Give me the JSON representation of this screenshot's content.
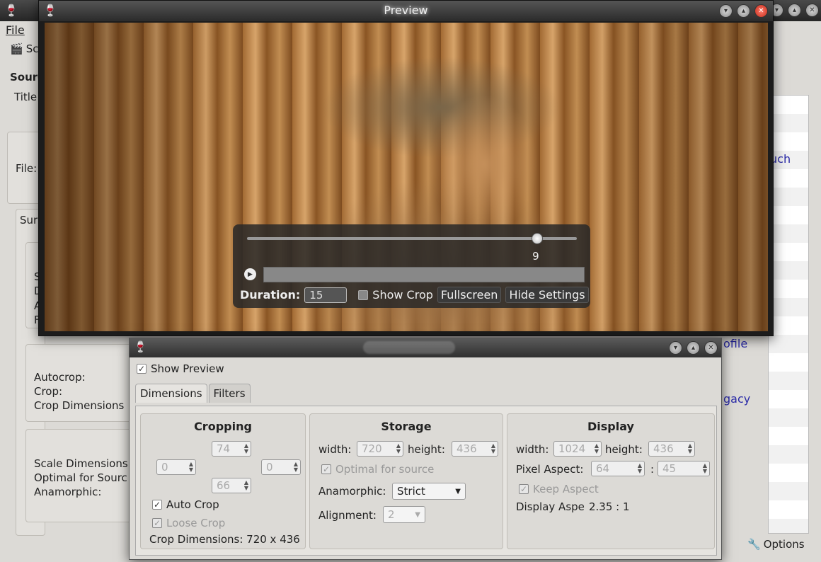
{
  "main": {
    "menu_file": "File",
    "toolbar_label": "Sc",
    "source_label": "Sourc",
    "title_label": "Title",
    "file_label": "File:",
    "summary_tab": "Sur",
    "group_letters": [
      "S",
      "D",
      "A",
      "F"
    ],
    "autocrop_label": "Autocrop:",
    "crop_label": "Crop:",
    "crop_dimensions_label": "Crop Dimensions",
    "scale_dimensions_label": "Scale Dimensions",
    "optimal_label": "Optimal for Sourc",
    "anamorphic_label": "Anamorphic:",
    "right_links": [
      "uch",
      "ofile",
      "gacy"
    ],
    "options_label": "Options"
  },
  "preview": {
    "title": "Preview",
    "slider_value": "9",
    "slider_position_pct": 88,
    "duration_label": "Duration:",
    "duration_value": "15",
    "show_crop_label": "Show Crop",
    "fullscreen_label": "Fullscreen",
    "hide_settings_label": "Hide Settings"
  },
  "settings": {
    "show_preview_label": "Show Preview",
    "tabs": [
      "Dimensions",
      "Filters"
    ],
    "cropping": {
      "title": "Cropping",
      "top": "74",
      "left": "0",
      "right": "0",
      "bottom": "66",
      "auto_crop_label": "Auto Crop",
      "loose_crop_label": "Loose Crop",
      "crop_dimensions_text": "Crop Dimensions: 720 x 436"
    },
    "storage": {
      "title": "Storage",
      "width_label": "width:",
      "width_value": "720",
      "height_label": "height:",
      "height_value": "436",
      "optimal_label": "Optimal for source",
      "anamorphic_label": "Anamorphic:",
      "anamorphic_value": "Strict",
      "alignment_label": "Alignment:",
      "alignment_value": "2"
    },
    "display": {
      "title": "Display",
      "width_label": "width:",
      "width_value": "1024",
      "height_label": "height:",
      "height_value": "436",
      "pixel_aspect_label": "Pixel Aspect:",
      "pixel_aspect_num": "64",
      "pixel_aspect_sep": ":",
      "pixel_aspect_den": "45",
      "keep_aspect_label": "Keep Aspect",
      "display_aspect_label": "Display Aspe",
      "display_aspect_value": "2.35 : 1"
    }
  },
  "colors": {
    "link": "#2a2aa8",
    "close_button": "#d33a28"
  },
  "icons": [
    "app-logo-icon",
    "clapper-icon",
    "minimize-icon",
    "maximize-icon",
    "close-icon",
    "play-icon",
    "wrench-icon",
    "checkmark-icon",
    "spin-arrows-icon",
    "dropdown-arrow-icon"
  ]
}
